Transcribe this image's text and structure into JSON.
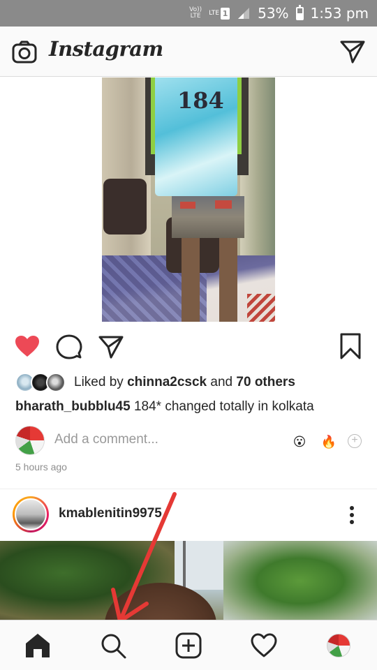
{
  "status_bar": {
    "volte": "Vo)) LTE",
    "network": "LTE",
    "sim": "1",
    "battery": "53%",
    "time": "1:53 pm"
  },
  "app_bar": {
    "title": "Instagram",
    "icons": {
      "left": "camera-icon",
      "right": "direct-message-icon"
    }
  },
  "post1": {
    "image_overlay_text": "184",
    "liked_by_prefix": "Liked by",
    "liked_by_user": "chinna2csck",
    "liked_by_and": "and",
    "liked_by_others": "70 others",
    "caption_user": "bharath_bubblu45",
    "caption_text": "184* changed totally in kolkata",
    "comment_placeholder": "Add a comment...",
    "quick_emojis": [
      "😮",
      "🔥"
    ],
    "timestamp": "5 hours ago",
    "liked": true,
    "like_color": "#ed4956"
  },
  "post2": {
    "username": "kmablenitin9975"
  },
  "bottom_nav": {
    "items": [
      "home-icon",
      "search-icon",
      "add-post-icon",
      "activity-heart-icon",
      "profile-avatar"
    ],
    "active": "home"
  },
  "annotation": {
    "arrow_color": "#e53935",
    "points_to": "search-icon"
  }
}
